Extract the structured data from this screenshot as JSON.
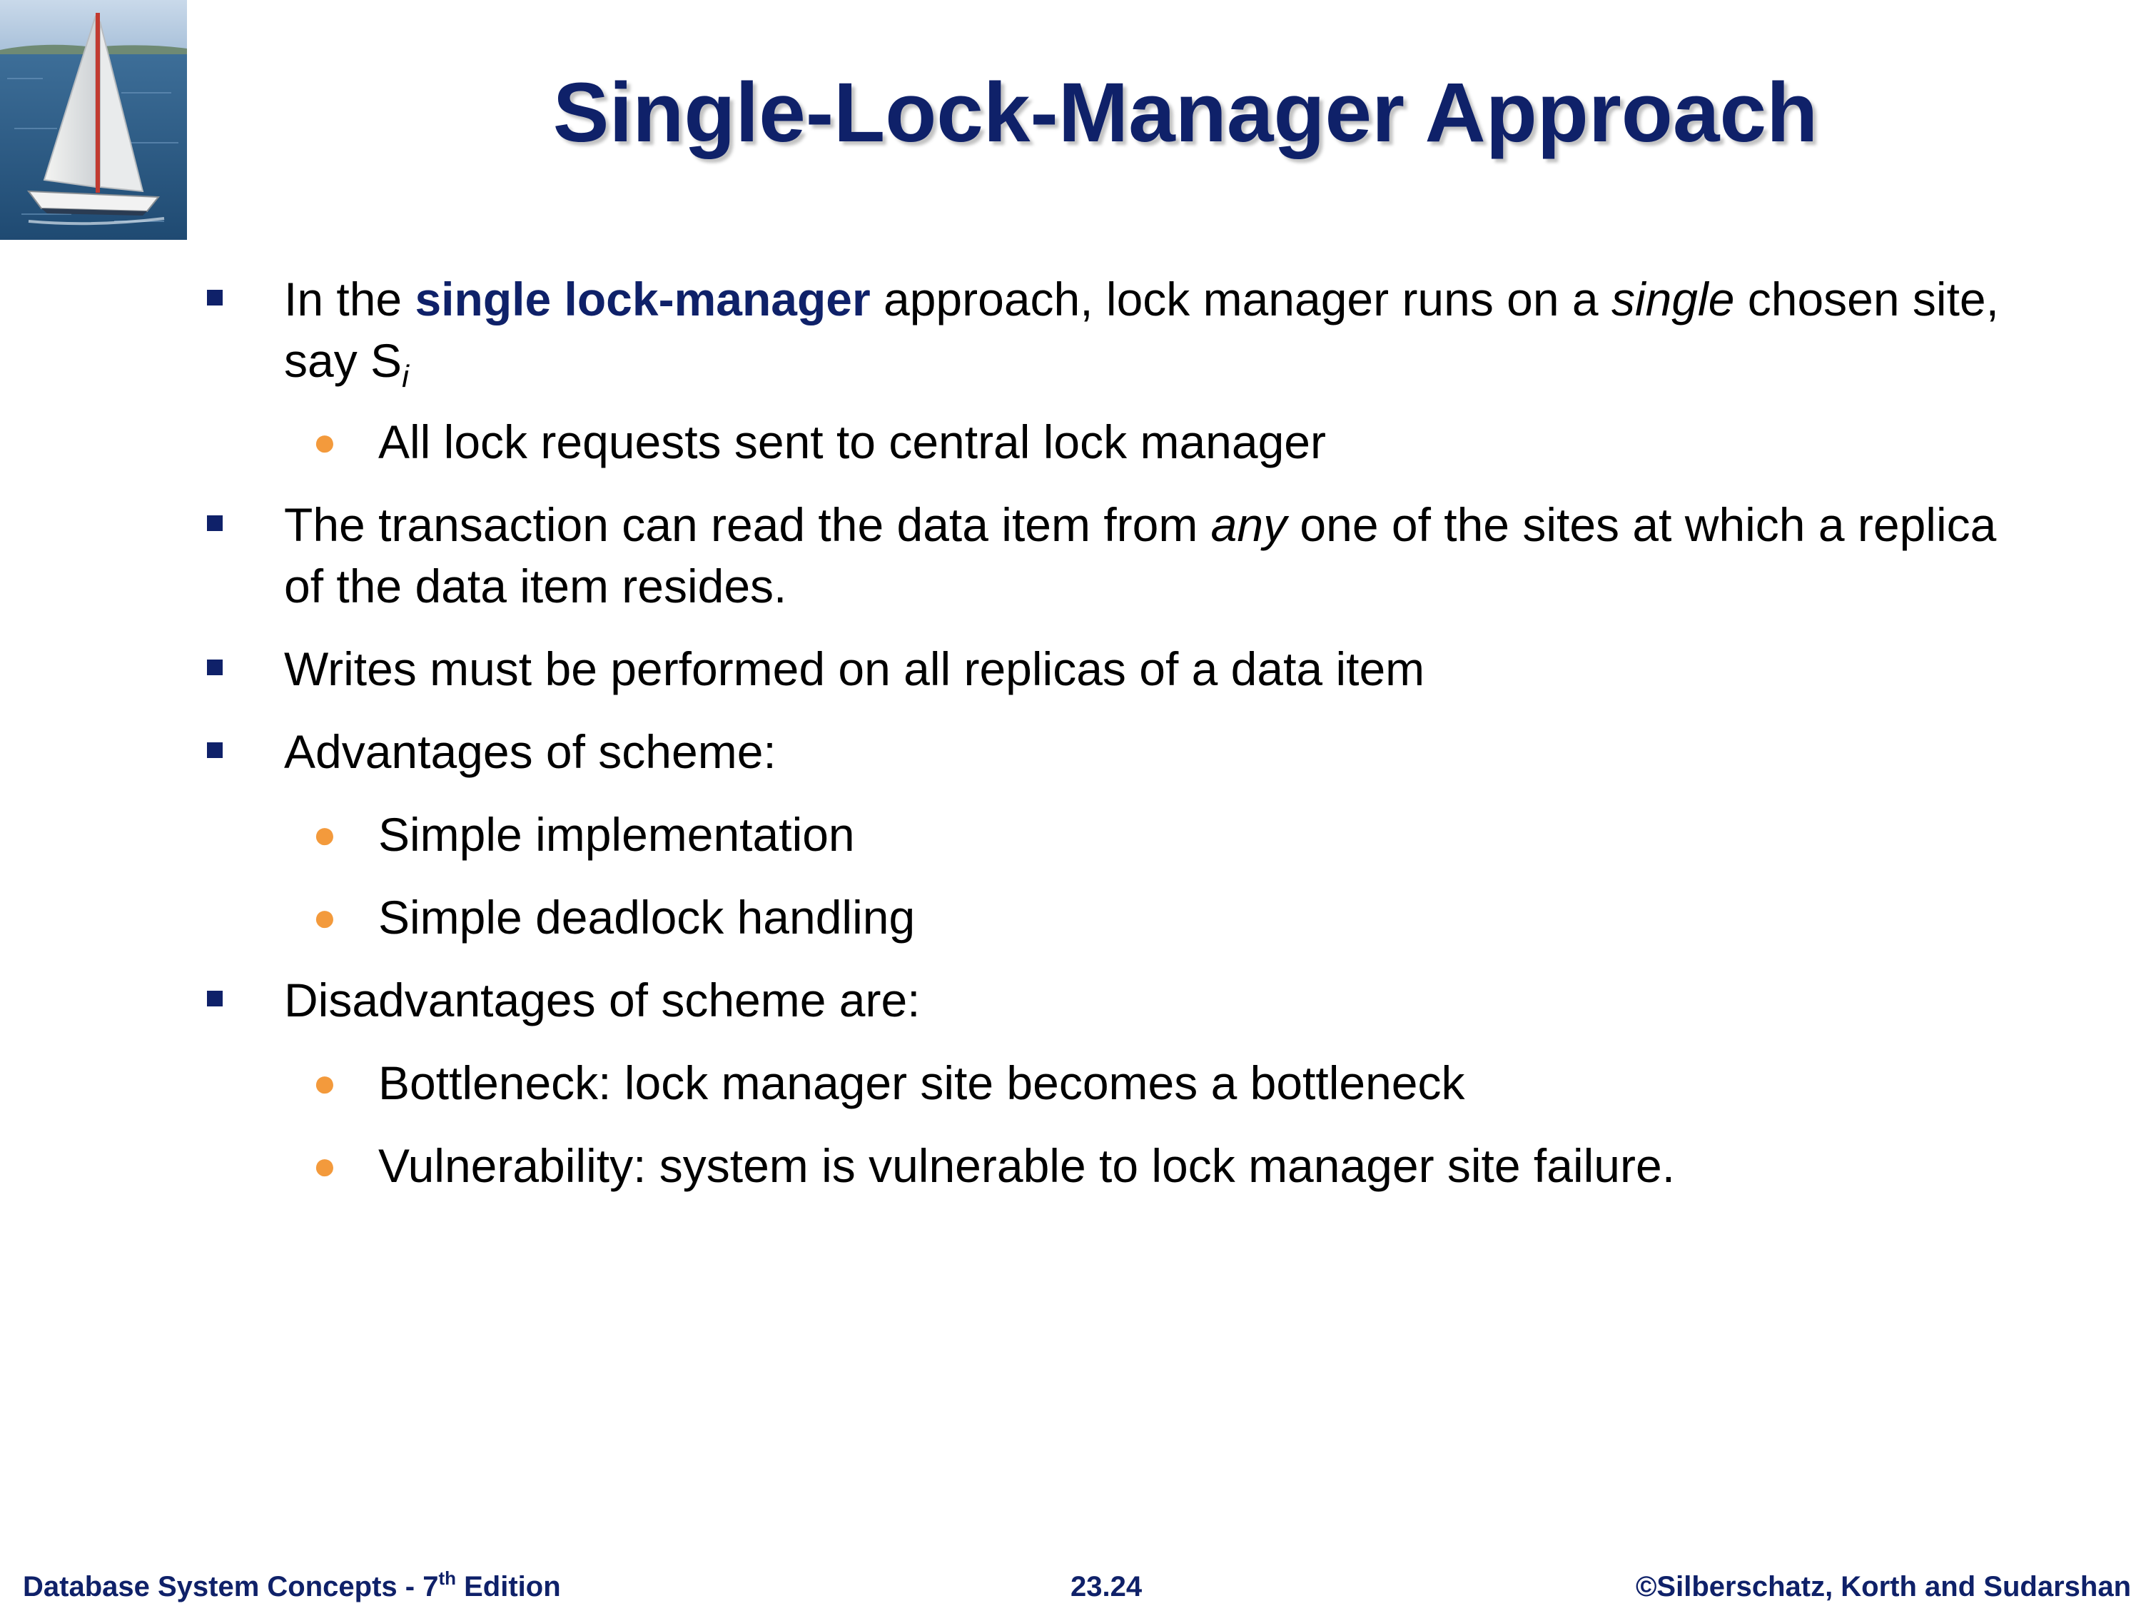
{
  "title": "Single-Lock-Manager Approach",
  "bullets": {
    "b1": {
      "pre": "In the ",
      "highlight": "single lock-manager",
      "mid": " approach, lock manager runs on a ",
      "italic": "single",
      "post": " chosen site, say S",
      "subscript": "i"
    },
    "b1_1": "All lock requests sent to central lock manager",
    "b2": {
      "pre": "The transaction can read the data item from ",
      "italic": "any",
      "post": " one of the sites at which a replica of the data item resides."
    },
    "b3": "Writes must be performed on all replicas of a data item",
    "b4": "Advantages of scheme:",
    "b4_1": "Simple implementation",
    "b4_2": "Simple deadlock handling",
    "b5": "Disadvantages of scheme are:",
    "b5_1": "Bottleneck: lock manager site becomes a bottleneck",
    "b5_2": "Vulnerability: system is vulnerable to lock manager site failure."
  },
  "footer": {
    "left_pre": "Database System Concepts - 7",
    "left_sup": "th",
    "left_post": " Edition",
    "center": "23.24",
    "right": "©Silberschatz, Korth and Sudarshan"
  },
  "colors": {
    "title": "#0f2169",
    "square_bullet": "#0f2169",
    "round_bullet": "#f39a3c",
    "footer_text": "#0f2169"
  },
  "icons": {
    "corner_image": "sailboat-photo",
    "level1_bullet": "square-bullet-icon",
    "level2_bullet": "round-bullet-icon"
  }
}
